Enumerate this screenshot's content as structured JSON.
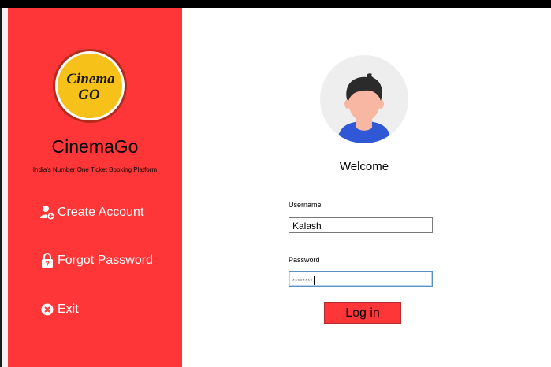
{
  "sidebar": {
    "logo_line1": "Cinema",
    "logo_line2": "GO",
    "brand": "CinemaGo",
    "tagline": "India's Number One Ticket Booking Platform",
    "menu": [
      {
        "label": "Create Account",
        "icon": "add-user-icon"
      },
      {
        "label": "Forgot Password",
        "icon": "lock-icon"
      },
      {
        "label": "Exit",
        "icon": "close-circle-icon"
      }
    ]
  },
  "main": {
    "welcome": "Welcome",
    "username_label": "Username",
    "username_value": "Kalash",
    "password_label": "Password",
    "password_value": "********",
    "login_label": "Log in"
  },
  "colors": {
    "sidebar_bg": "#fe3638",
    "logo_yellow": "#f6c21a",
    "avatar_bg": "#eeeeee",
    "shirt_blue": "#2f57d6"
  }
}
